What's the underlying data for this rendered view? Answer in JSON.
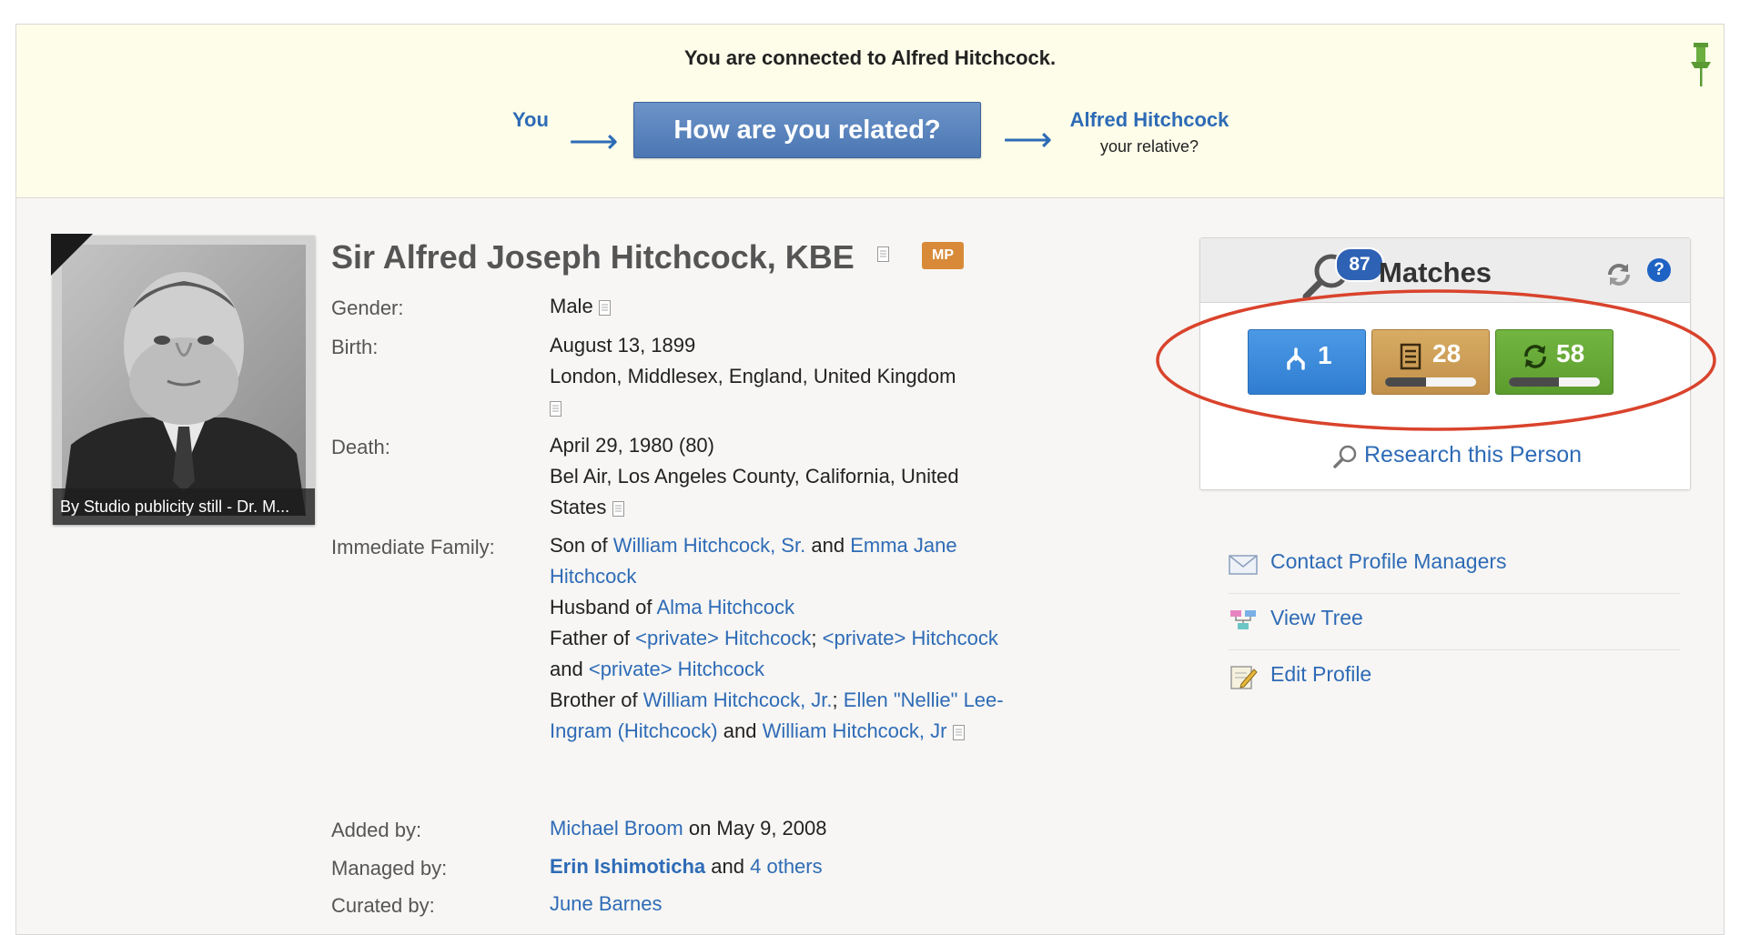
{
  "banner": {
    "title": "You are connected to Alfred Hitchcock.",
    "you_label": "You",
    "arrow": "⟶",
    "button_label": "How are you related?",
    "relative_name": "Alfred Hitchcock",
    "relative_sub": "your relative?"
  },
  "photo": {
    "caption": "By Studio publicity still - Dr. M..."
  },
  "profile": {
    "name": "Sir Alfred Joseph Hitchcock, KBE",
    "badge": "MP",
    "gender_label": "Gender:",
    "gender_value": "Male",
    "birth_label": "Birth:",
    "birth_date": "August 13, 1899",
    "birth_place": "London, Middlesex, England, United Kingdom",
    "death_label": "Death:",
    "death_date": "April 29, 1980 (80)",
    "death_place": "Bel Air, Los Angeles County, California, United States",
    "family_label": "Immediate Family:",
    "family": {
      "son_of": "Son of",
      "father1": "William Hitchcock, Sr.",
      "and1": "and",
      "mother": "Emma Jane Hitchcock",
      "husband_of": "Husband of",
      "wife": "Alma Hitchcock",
      "father_of": "Father of",
      "child1": "<private> Hitchcock",
      "semi1": ";",
      "child2": "<private> Hitchcock",
      "and2": "and",
      "child3": "<private> Hitchcock",
      "brother_of": "Brother of",
      "sib1": "William Hitchcock, Jr.",
      "semi2": ";",
      "sib2": "Ellen \"Nellie\" Lee-Ingram (Hitchcock)",
      "and3": "and",
      "sib3": "William Hitchcock, Jr"
    },
    "added_label": "Added by:",
    "added_by": "Michael Broom",
    "added_on": "on May 9, 2008",
    "managed_label": "Managed by:",
    "managed_by": "Erin Ishimoticha",
    "managed_and": "and",
    "managed_others": "4 others",
    "curated_label": "Curated by:",
    "curated_by": "June Barnes"
  },
  "matches": {
    "title": "Matches",
    "count": "87",
    "help": "?",
    "tree_count": "1",
    "record_count": "28",
    "record_progress": 0.45,
    "smart_count": "58",
    "smart_progress": 0.55,
    "research_label": "Research this Person"
  },
  "actions": {
    "contact": "Contact Profile Managers",
    "view_tree": "View Tree",
    "edit": "Edit Profile"
  },
  "colors": {
    "link": "#2e6bb6",
    "banner_bg": "#fdfde9",
    "tree_btn": "#2f7dd1",
    "record_btn": "#c1904a",
    "smart_btn": "#5c9c2e",
    "highlight_ellipse": "#d9432c"
  }
}
